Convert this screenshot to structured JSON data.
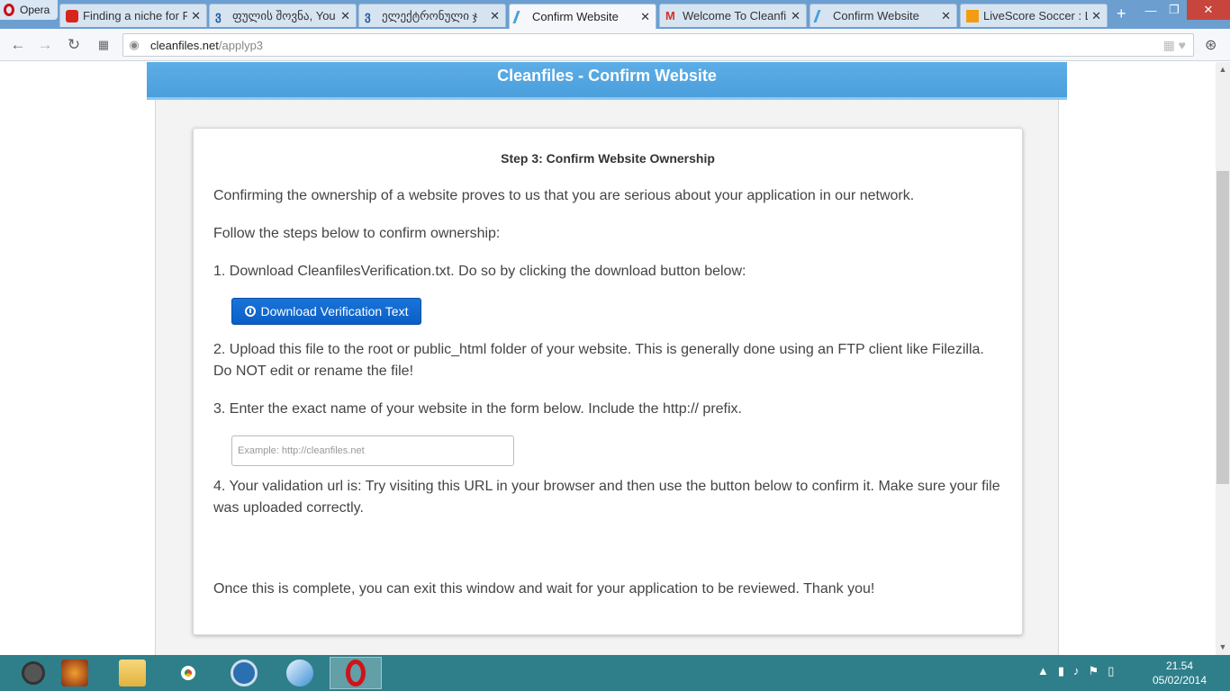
{
  "browser": {
    "menu_label": "Opera",
    "tabs": [
      {
        "title": "Finding a niche for PR",
        "icon": "youtube-icon",
        "active": false
      },
      {
        "title": "ფულის შოვნა, You",
        "icon": "georgian-site-icon",
        "active": false
      },
      {
        "title": "ელექტრონული ჯ",
        "icon": "georgian-site-icon",
        "active": false
      },
      {
        "title": "Confirm Website",
        "icon": "cleanfiles-icon",
        "active": true
      },
      {
        "title": "Welcome To Cleanfil",
        "icon": "gmail-icon",
        "active": false
      },
      {
        "title": "Confirm Website",
        "icon": "cleanfiles-icon",
        "active": false
      },
      {
        "title": "LiveScore Soccer : Liv",
        "icon": "livescore-icon",
        "active": false
      }
    ],
    "url_domain": "cleanfiles.net",
    "url_path": "/applyp3"
  },
  "page": {
    "header_title": "Cleanfiles - Confirm Website",
    "step_title": "Step 3: Confirm Website Ownership",
    "intro": "Confirming the ownership of a website proves to us that you are serious about your application in our network.",
    "follow": "Follow the steps below to confirm ownership:",
    "step1": "1. Download CleanfilesVerification.txt. Do so by clicking the download button below:",
    "download_button": "Download Verification Text",
    "step2": "2. Upload this file to the root or public_html folder of your website. This is generally done using an FTP client like Filezilla. Do NOT edit or rename the file!",
    "step3": "3. Enter the exact name of your website in the form below. Include the http:// prefix.",
    "website_placeholder": "Example: http://cleanfiles.net",
    "website_value": "",
    "step4": "4. Your validation url is: Try visiting this URL in your browser and then use the button below to confirm it. Make sure your file was uploaded correctly.",
    "closing": "Once this is complete, you can exit this window and wait for your application to be reviewed. Thank you!"
  },
  "taskbar": {
    "apps": [
      "sync-icon",
      "game-icon",
      "file-explorer-icon",
      "chrome-icon",
      "browser-icon",
      "bird-app-icon",
      "opera-icon"
    ],
    "time": "21.54",
    "date": "05/02/2014"
  },
  "colors": {
    "tabbar": "#6c9fd0",
    "header": "#4a9fdc",
    "button": "#0a5fc6",
    "taskbar": "#2e7f8a"
  }
}
